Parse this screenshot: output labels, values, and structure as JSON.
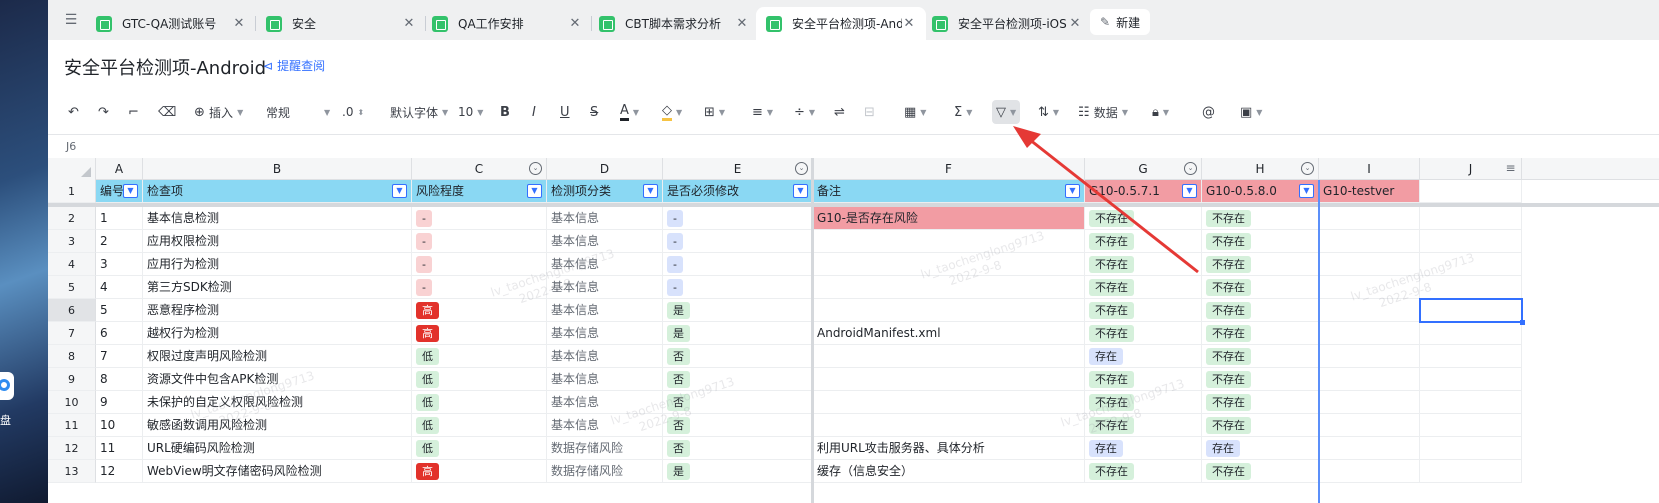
{
  "desktop": {
    "label": "盘"
  },
  "tabs": [
    {
      "label": "GTC-QA测试账号"
    },
    {
      "label": "安全"
    },
    {
      "label": "QA工作安排"
    },
    {
      "label": "CBT脚本需求分析"
    },
    {
      "label": "安全平台检测项-Android"
    },
    {
      "label": "安全平台检测项-iOS"
    }
  ],
  "new_button": "新建",
  "doc_title": "安全平台检测项-Android",
  "remind_label": "提醒查阅",
  "toolbar": {
    "insert": "插入",
    "format": "常规",
    "decimal": ".0",
    "font": "默认字体",
    "size": "10",
    "data": "数据"
  },
  "cell_ref": "J6",
  "columns": [
    "A",
    "B",
    "C",
    "D",
    "E",
    "F",
    "G",
    "H",
    "I",
    "J"
  ],
  "headers": [
    "编号",
    "检查项",
    "风险程度",
    "检测项分类",
    "是否必须修改",
    "备注",
    "G10-0.5.7.1",
    "G10-0.5.8.0",
    "G10-testver"
  ],
  "rows": [
    {
      "row": "2",
      "id": "1",
      "item": "基本信息检测",
      "risk": "-",
      "cat": "基本信息",
      "must": "-",
      "note": "G10-是否存在风险",
      "g": "不存在",
      "h": "不存在"
    },
    {
      "row": "3",
      "id": "2",
      "item": "应用权限检测",
      "risk": "-",
      "cat": "基本信息",
      "must": "-",
      "note": "",
      "g": "不存在",
      "h": "不存在"
    },
    {
      "row": "4",
      "id": "3",
      "item": "应用行为检测",
      "risk": "-",
      "cat": "基本信息",
      "must": "-",
      "note": "",
      "g": "不存在",
      "h": "不存在"
    },
    {
      "row": "5",
      "id": "4",
      "item": "第三方SDK检测",
      "risk": "-",
      "cat": "基本信息",
      "must": "-",
      "note": "",
      "g": "不存在",
      "h": "不存在"
    },
    {
      "row": "6",
      "id": "5",
      "item": "恶意程序检测",
      "risk": "高",
      "cat": "基本信息",
      "must": "是",
      "note": "",
      "g": "不存在",
      "h": "不存在"
    },
    {
      "row": "7",
      "id": "6",
      "item": " 越权行为检测",
      "risk": "高",
      "cat": "基本信息",
      "must": "是",
      "note": "AndroidManifest.xml",
      "g": "不存在",
      "h": "不存在"
    },
    {
      "row": "8",
      "id": "7",
      "item": "权限过度声明风险检测",
      "risk": "低",
      "cat": "基本信息",
      "must": "否",
      "note": "",
      "g": "存在",
      "h": "不存在"
    },
    {
      "row": "9",
      "id": "8",
      "item": "资源文件中包含APK检测",
      "risk": "低",
      "cat": "基本信息",
      "must": "否",
      "note": "",
      "g": "不存在",
      "h": "不存在"
    },
    {
      "row": "10",
      "id": "9",
      "item": "未保护的自定义权限风险检测",
      "risk": "低",
      "cat": "基本信息",
      "must": "否",
      "note": "",
      "g": "不存在",
      "h": "不存在"
    },
    {
      "row": "11",
      "id": "10",
      "item": "敏感函数调用风险检测",
      "risk": "低",
      "cat": "基本信息",
      "must": "否",
      "note": "",
      "g": "不存在",
      "h": "不存在"
    },
    {
      "row": "12",
      "id": "11",
      "item": "URL硬编码风险检测",
      "risk": "低",
      "cat": "数据存储风险",
      "must": "否",
      "note": "利用URL攻击服务器、具体分析",
      "g": "存在",
      "h": "存在"
    },
    {
      "row": "13",
      "id": "12",
      "item": "WebView明文存储密码风险检测",
      "risk": "高",
      "cat": "数据存储风险",
      "must": "是",
      "note": "缓存（信息安全）",
      "g": "不存在",
      "h": "不存在"
    }
  ],
  "watermark": [
    "lv_taochenglong9713",
    "2022-9-8"
  ],
  "colors": {
    "header": "#8ad8f3",
    "header_pink": "#f29ca3",
    "accent": "#3370ff",
    "high": "#e2322b",
    "arrow": "#e53935"
  }
}
